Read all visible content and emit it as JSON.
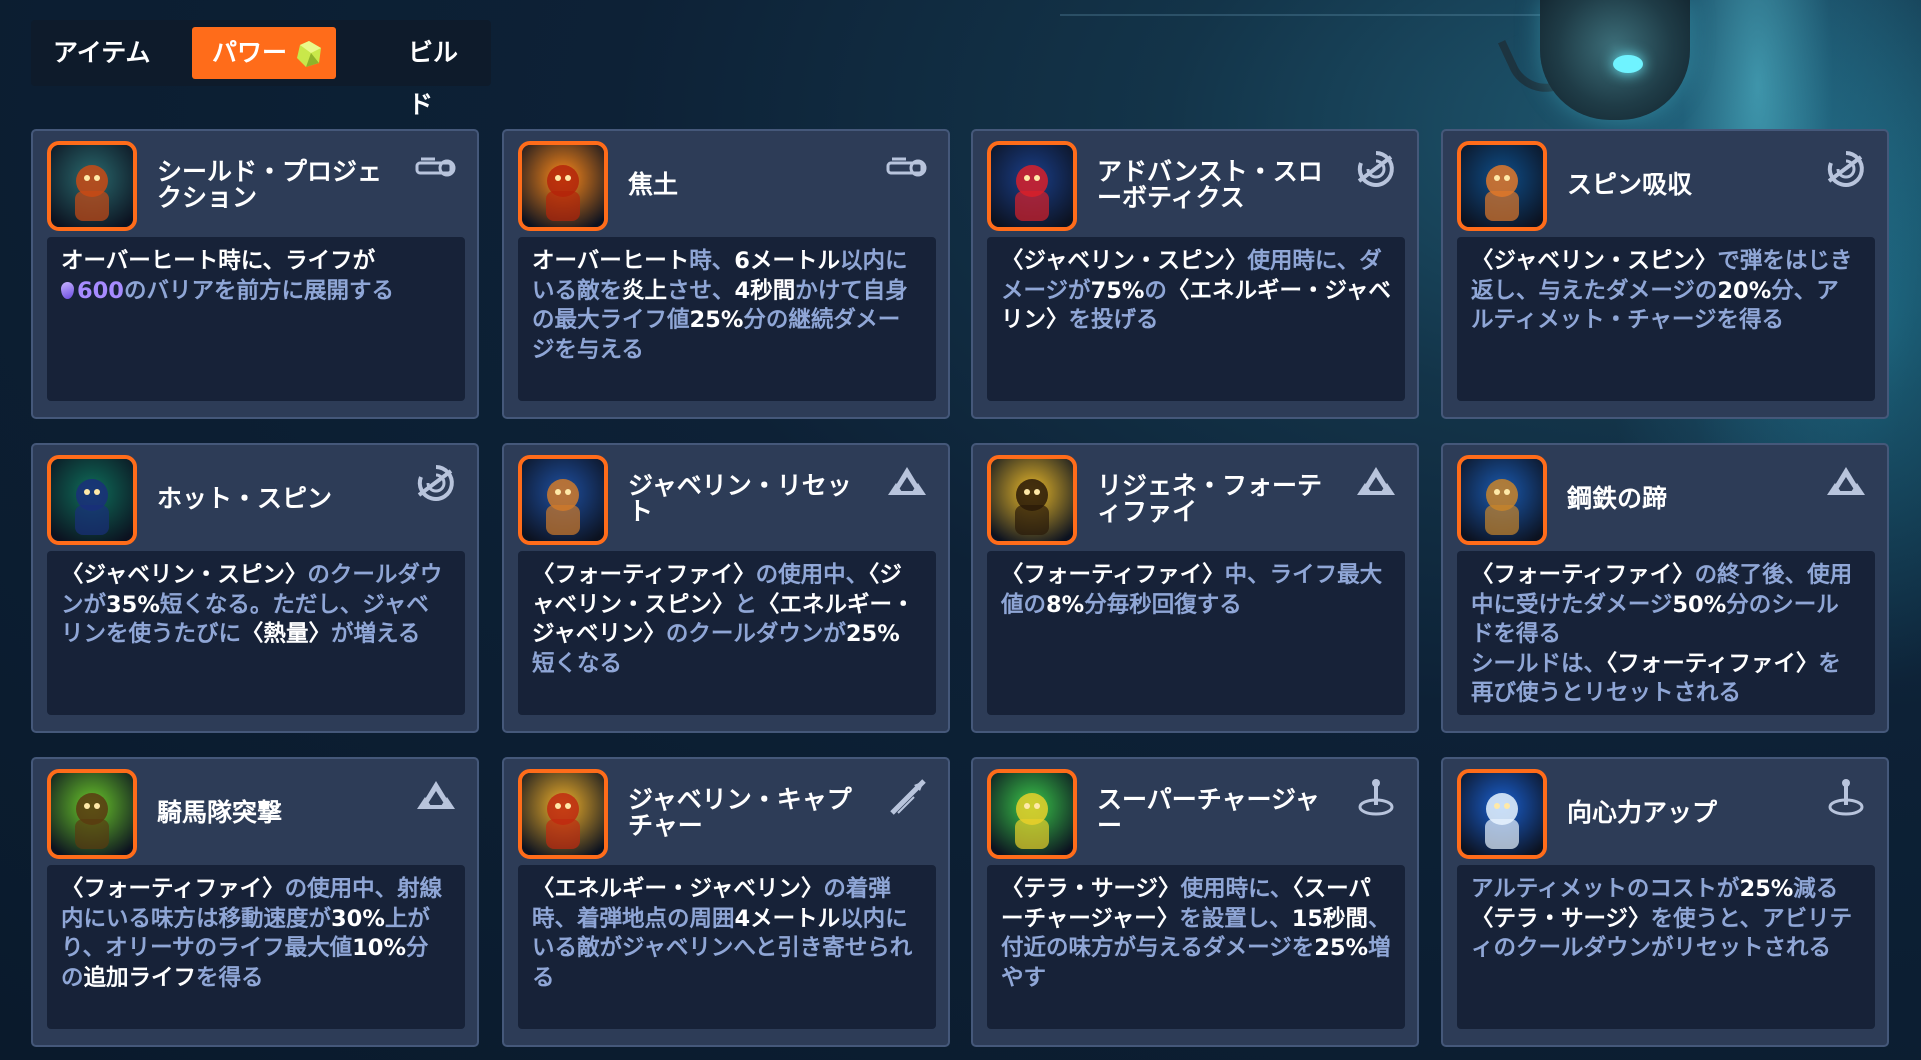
{
  "tabs": {
    "items_label": "アイテム",
    "power_label": "パワー",
    "build_label": "ビルド",
    "active": "power"
  },
  "cards": [
    {
      "title": "シールド・プロジェクション",
      "icon": "shield-projection-icon",
      "tag_icon": "gun-icon",
      "desc": [
        {
          "t": "オーバーヒート",
          "s": "w"
        },
        {
          "t": "時に、ライフが",
          "s": "w"
        },
        {
          "t": "\n",
          "s": ""
        },
        {
          "t": "600",
          "s": "p"
        },
        {
          "t": "のバリアを前方に展開する",
          "s": ""
        }
      ]
    },
    {
      "title": "焦土",
      "icon": "scorched-earth-icon",
      "tag_icon": "gun-icon",
      "desc": [
        {
          "t": "オーバーヒート",
          "s": "w"
        },
        {
          "t": "時、",
          "s": ""
        },
        {
          "t": "6メートル",
          "s": "w"
        },
        {
          "t": "以内にいる敵を",
          "s": ""
        },
        {
          "t": "炎上",
          "s": "w"
        },
        {
          "t": "させ、",
          "s": ""
        },
        {
          "t": "4秒間",
          "s": "w"
        },
        {
          "t": "かけて自身の最大ライフ値",
          "s": ""
        },
        {
          "t": "25%",
          "s": "w"
        },
        {
          "t": "分の継続ダメージを与える",
          "s": ""
        }
      ]
    },
    {
      "title": "アドバンスト・スローボティクス",
      "icon": "advanced-throwbotics-icon",
      "tag_icon": "spin-icon",
      "desc": [
        {
          "t": "〈ジャベリン・スピン〉",
          "s": "w"
        },
        {
          "t": "使用時に、ダメージが",
          "s": ""
        },
        {
          "t": "75%",
          "s": "w"
        },
        {
          "t": "の",
          "s": ""
        },
        {
          "t": "〈エネルギー・ジャベリン〉",
          "s": "w"
        },
        {
          "t": "を投げる",
          "s": ""
        }
      ]
    },
    {
      "title": "スピン吸収",
      "icon": "spin-absorb-icon",
      "tag_icon": "spin-icon",
      "desc": [
        {
          "t": "〈ジャベリン・スピン〉",
          "s": "w"
        },
        {
          "t": "で弾をはじき返し、与えたダメージの",
          "s": ""
        },
        {
          "t": "20%",
          "s": "w"
        },
        {
          "t": "分、アルティメット・チャージを得る",
          "s": ""
        }
      ]
    },
    {
      "title": "ホット・スピン",
      "icon": "hot-spin-icon",
      "tag_icon": "spin-icon",
      "desc": [
        {
          "t": "〈ジャベリン・スピン〉",
          "s": "w"
        },
        {
          "t": "のクールダウンが",
          "s": ""
        },
        {
          "t": "35%",
          "s": "w"
        },
        {
          "t": "短くなる。ただし、ジャベリンを使うたびに",
          "s": ""
        },
        {
          "t": "〈熱量〉",
          "s": "w"
        },
        {
          "t": "が増える",
          "s": ""
        }
      ]
    },
    {
      "title": "ジャベリン・リセット",
      "icon": "javelin-reset-icon",
      "tag_icon": "fortify-icon",
      "desc": [
        {
          "t": "〈フォーティファイ〉",
          "s": "w"
        },
        {
          "t": "の使用中、",
          "s": ""
        },
        {
          "t": "〈ジャベリン・スピン〉",
          "s": "w"
        },
        {
          "t": "と",
          "s": ""
        },
        {
          "t": "〈エネルギー・ジャベリン〉",
          "s": "w"
        },
        {
          "t": "のクールダウンが",
          "s": ""
        },
        {
          "t": "25%",
          "s": "w"
        },
        {
          "t": "短くなる",
          "s": ""
        }
      ]
    },
    {
      "title": "リジェネ・フォーティファイ",
      "icon": "regen-fortify-icon",
      "tag_icon": "fortify-icon",
      "desc": [
        {
          "t": "〈フォーティファイ〉",
          "s": "w"
        },
        {
          "t": "中、ライフ最大値の",
          "s": ""
        },
        {
          "t": "8%",
          "s": "w"
        },
        {
          "t": "分毎秒回復する",
          "s": ""
        }
      ]
    },
    {
      "title": "鋼鉄の蹄",
      "icon": "steel-hooves-icon",
      "tag_icon": "fortify-icon",
      "desc": [
        {
          "t": "〈フォーティファイ〉",
          "s": "w"
        },
        {
          "t": "の終了後、使用中に受けたダメージ",
          "s": ""
        },
        {
          "t": "50%",
          "s": "w"
        },
        {
          "t": "分のシールドを得る",
          "s": ""
        },
        {
          "t": "\n",
          "s": ""
        },
        {
          "t": "シールドは、",
          "s": ""
        },
        {
          "t": "〈フォーティファイ〉",
          "s": "w"
        },
        {
          "t": "を再び使うとリセットされる",
          "s": ""
        }
      ]
    },
    {
      "title": "騎馬隊突撃",
      "icon": "cavalry-charge-icon",
      "tag_icon": "fortify-icon",
      "desc": [
        {
          "t": "〈フォーティファイ〉",
          "s": "w"
        },
        {
          "t": "の使用中、射線内にいる味方は移動速度が",
          "s": ""
        },
        {
          "t": "30%",
          "s": "w"
        },
        {
          "t": "上がり、オリーサのライフ最大値",
          "s": ""
        },
        {
          "t": "10%",
          "s": "w"
        },
        {
          "t": "分の",
          "s": ""
        },
        {
          "t": "追加ライフ",
          "s": "w"
        },
        {
          "t": "を得る",
          "s": ""
        }
      ]
    },
    {
      "title": "ジャベリン・キャプチャー",
      "icon": "javelin-capture-icon",
      "tag_icon": "javelin-icon",
      "desc": [
        {
          "t": "〈エネルギー・ジャベリン〉",
          "s": "w"
        },
        {
          "t": "の着弾時、着弾地点の周囲",
          "s": ""
        },
        {
          "t": "4メートル",
          "s": "w"
        },
        {
          "t": "以内にいる敵がジャベリンへと引き寄せられる",
          "s": ""
        }
      ]
    },
    {
      "title": "スーパーチャージャー",
      "icon": "supercharger-icon",
      "tag_icon": "ultimate-icon",
      "desc": [
        {
          "t": "〈テラ・サージ〉",
          "s": "w"
        },
        {
          "t": "使用時に、",
          "s": ""
        },
        {
          "t": "〈スーパーチャージャー〉",
          "s": "w"
        },
        {
          "t": "を設置し、",
          "s": ""
        },
        {
          "t": "15秒間",
          "s": "w"
        },
        {
          "t": "、付近の味方が与えるダメージを",
          "s": ""
        },
        {
          "t": "25%",
          "s": "w"
        },
        {
          "t": "増やす",
          "s": ""
        }
      ]
    },
    {
      "title": "向心力アップ",
      "icon": "centripetal-charge-icon",
      "tag_icon": "ultimate-icon",
      "desc": [
        {
          "t": "アルティメットのコストが",
          "s": ""
        },
        {
          "t": "25%",
          "s": "w"
        },
        {
          "t": "減る",
          "s": ""
        },
        {
          "t": "\n",
          "s": ""
        },
        {
          "t": "〈テラ・サージ〉",
          "s": "w"
        },
        {
          "t": "を使うと、アビリティのクールダウンがリセットされる",
          "s": ""
        }
      ]
    }
  ]
}
